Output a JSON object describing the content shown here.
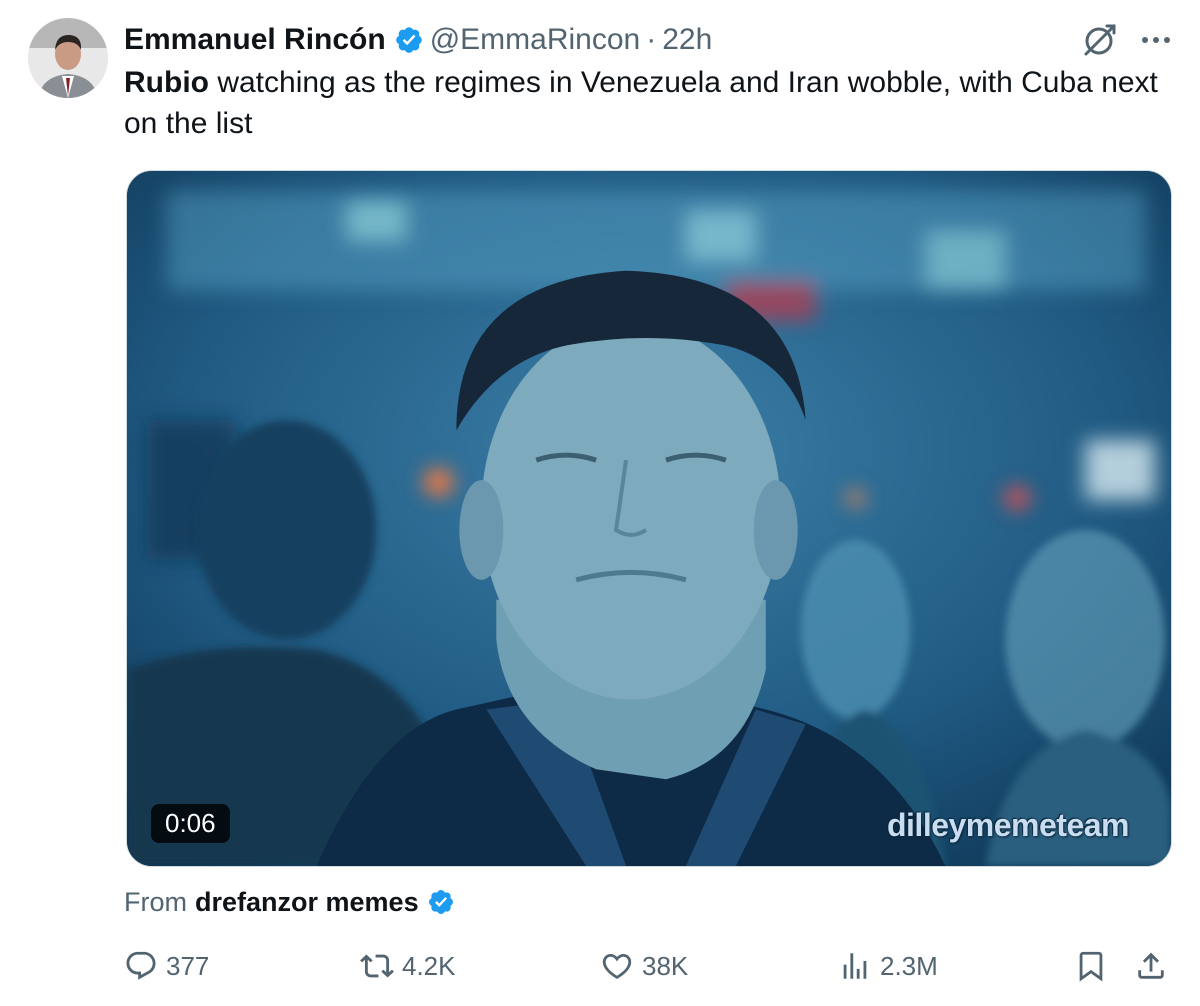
{
  "tweet": {
    "author_name": "Emmanuel Rincón",
    "handle": "@EmmaRincon",
    "separator": "·",
    "time": "22h",
    "text_bold": "Rubio",
    "text_rest": " watching as the regimes in Venezuela and Iran wobble, with Cuba next on the list"
  },
  "media": {
    "duration": "0:06",
    "watermark": "dilleymemeteam"
  },
  "source": {
    "prefix": "From",
    "name": "drefanzor memes"
  },
  "actions": {
    "replies": "377",
    "reposts": "4.2K",
    "likes": "38K",
    "views": "2.3M"
  },
  "icons": {
    "verified": "verified-badge-icon",
    "grok": "grok-icon",
    "more": "more-icon",
    "reply": "reply-icon",
    "repost": "repost-icon",
    "like": "heart-icon",
    "views": "views-icon",
    "bookmark": "bookmark-icon",
    "share": "share-icon"
  },
  "colors": {
    "text": "#0f1419",
    "secondary": "#536471",
    "verified": "#1d9bf0"
  }
}
